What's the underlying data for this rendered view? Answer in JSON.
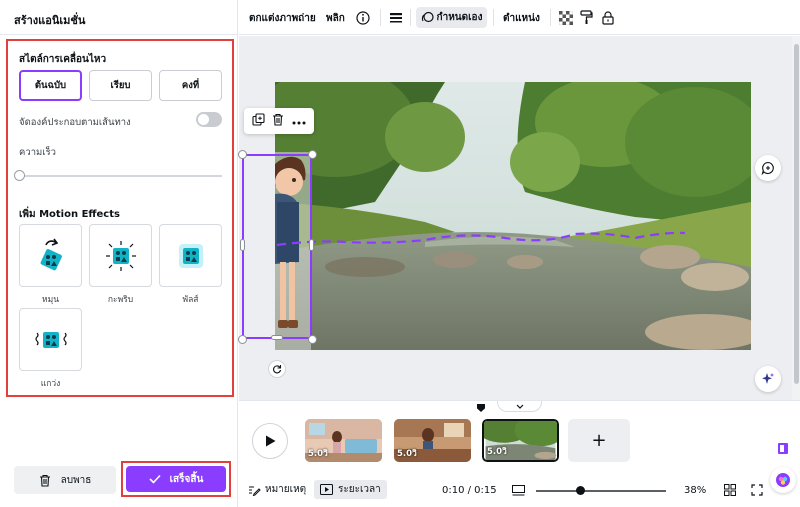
{
  "panel": {
    "title": "สร้างแอนิเมชั่น",
    "style_heading": "สไตล์การเคลื่อนไหว",
    "styles": [
      {
        "label": "ต้นฉบับ",
        "selected": true
      },
      {
        "label": "เรียบ",
        "selected": false
      },
      {
        "label": "คงที่",
        "selected": false
      }
    ],
    "align_path_label": "จัดองค์ประกอบตามเส้นทาง",
    "align_path_on": false,
    "speed_label": "ความเร็ว",
    "speed_value": 0,
    "effects_heading": "เพิ่ม Motion Effects",
    "effects": [
      {
        "label": "หมุน",
        "icon": "spin-effect-icon"
      },
      {
        "label": "กะพริบ",
        "icon": "flicker-effect-icon"
      },
      {
        "label": "พัลส์",
        "icon": "pulse-effect-icon"
      },
      {
        "label": "แกว่ง",
        "icon": "wiggle-effect-icon"
      }
    ],
    "delete_label": "ลบพาธ",
    "done_label": "เสร็จสิ้น"
  },
  "toolbar": {
    "edit_photo": "ตกแต่งภาพถ่าย",
    "flip": "พลิก",
    "custom": "กำหนดเอง",
    "position": "ตำแหน่ง"
  },
  "timeline": {
    "pages": [
      {
        "duration": "5.0วิ",
        "active": false
      },
      {
        "duration": "5.0วิ",
        "active": false
      },
      {
        "duration": "5.0วิ",
        "active": true
      }
    ],
    "notes_label": "หมายเหตุ",
    "timing_label": "ระยะเวลา",
    "time": "0:10 / 0:15",
    "zoom_percent": "38%",
    "zoom_value": 0.38
  },
  "colors": {
    "accent": "#8b3dff",
    "highlight": "#e1403c",
    "effect_teal": "#13b3c7"
  }
}
